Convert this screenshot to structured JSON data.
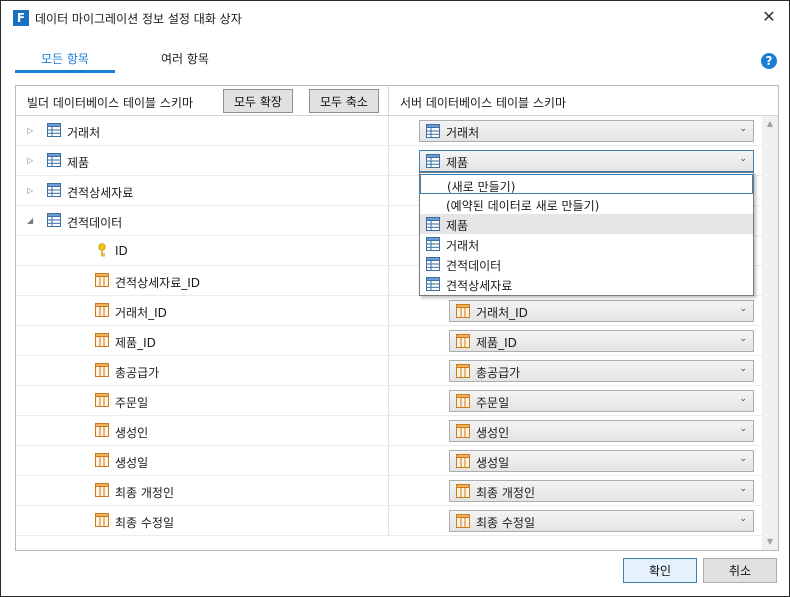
{
  "window": {
    "title": "데이터 마이그레이션 정보 설정 대화 상자",
    "close_glyph": "✕",
    "app_icon_letter": "F"
  },
  "tabs": [
    {
      "label": "모든 항목",
      "active": true
    },
    {
      "label": "여러 항목",
      "active": false
    }
  ],
  "help_glyph": "?",
  "header": {
    "left_label": "빌더 데이터베이스 테이블 스키마",
    "expand_all": "모두 확장",
    "collapse_all": "모두 축소",
    "right_label": "서버 데이터베이스 테이블 스키마"
  },
  "tree_rows": [
    {
      "label": "거래처",
      "kind": "table",
      "toggle": "▷",
      "mapping": "거래처",
      "mapping_icon": "table-icon"
    },
    {
      "label": "제품",
      "kind": "table",
      "toggle": "▷",
      "mapping": "제품",
      "mapping_icon": "table-icon"
    },
    {
      "label": "견적상세자료",
      "kind": "table",
      "toggle": "▷",
      "mapping": "",
      "mapping_icon": ""
    },
    {
      "label": "견적데이터",
      "kind": "table",
      "toggle": "◢",
      "mapping": "",
      "mapping_icon": ""
    },
    {
      "label": "ID",
      "kind": "key",
      "toggle": "",
      "mapping": "",
      "mapping_icon": ""
    },
    {
      "label": "견적상세자료_ID",
      "kind": "field",
      "toggle": "",
      "mapping": "",
      "mapping_icon": ""
    },
    {
      "label": "거래처_ID",
      "kind": "field",
      "toggle": "",
      "mapping": "거래처_ID",
      "mapping_icon": "field-icon"
    },
    {
      "label": "제품_ID",
      "kind": "field",
      "toggle": "",
      "mapping": "제품_ID",
      "mapping_icon": "field-icon"
    },
    {
      "label": "총공급가",
      "kind": "field",
      "toggle": "",
      "mapping": "총공급가",
      "mapping_icon": "field-icon"
    },
    {
      "label": "주문일",
      "kind": "field",
      "toggle": "",
      "mapping": "주문일",
      "mapping_icon": "field-icon"
    },
    {
      "label": "생성인",
      "kind": "field",
      "toggle": "",
      "mapping": "생성인",
      "mapping_icon": "field-icon"
    },
    {
      "label": "생성일",
      "kind": "field",
      "toggle": "",
      "mapping": "생성일",
      "mapping_icon": "field-icon"
    },
    {
      "label": "최종 개정인",
      "kind": "field",
      "toggle": "",
      "mapping": "최종 개정인",
      "mapping_icon": "field-icon"
    },
    {
      "label": "최종 수정일",
      "kind": "field",
      "toggle": "",
      "mapping": "최종 수정일",
      "mapping_icon": "field-icon"
    }
  ],
  "dropdown": {
    "open_for": "제품",
    "items": [
      {
        "label": "(새로 만들기)",
        "icon": "",
        "state": "focused"
      },
      {
        "label": "(예약된 데이터로 새로 만들기)",
        "icon": "",
        "state": ""
      },
      {
        "label": "제품",
        "icon": "table-icon",
        "state": "hover"
      },
      {
        "label": "거래처",
        "icon": "table-icon",
        "state": ""
      },
      {
        "label": "견적데이터",
        "icon": "table-icon",
        "state": ""
      },
      {
        "label": "견적상세자료",
        "icon": "table-icon",
        "state": ""
      }
    ]
  },
  "scrollbar": {
    "up": "▲",
    "down": "▼"
  },
  "footer": {
    "ok": "확인",
    "cancel": "취소"
  },
  "colors": {
    "accent": "#1a7fd4",
    "table_icon": "#3a6ea5",
    "field_icon": "#d98c2b",
    "key_icon": "#e0b33a"
  }
}
